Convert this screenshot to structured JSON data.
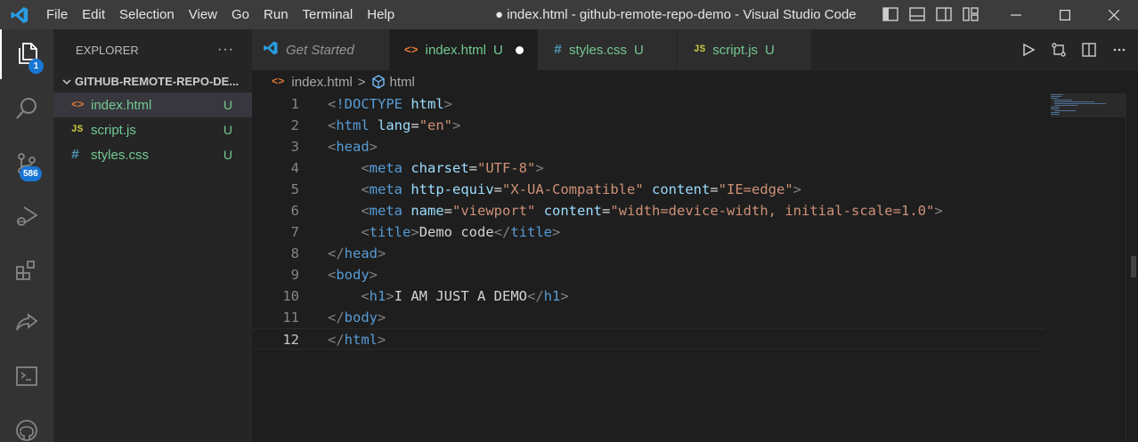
{
  "titlebar": {
    "menu": [
      "File",
      "Edit",
      "Selection",
      "View",
      "Go",
      "Run",
      "Terminal",
      "Help"
    ],
    "window_title": "● index.html - github-remote-repo-demo - Visual Studio Code"
  },
  "activity": {
    "explorer_badge": "1",
    "scm_badge": "586"
  },
  "sidebar": {
    "title": "EXPLORER",
    "more": "···",
    "folder": "GITHUB-REMOTE-REPO-DE...",
    "files": [
      {
        "icon": "<>",
        "name": "index.html",
        "status": "U"
      },
      {
        "icon": "JS",
        "name": "script.js",
        "status": "U"
      },
      {
        "icon": "#",
        "name": "styles.css",
        "status": "U"
      }
    ]
  },
  "tabs": [
    {
      "icon": "vscode-icon",
      "label": "Get Started",
      "status": ""
    },
    {
      "icon": "<>",
      "label": "index.html",
      "status": "U"
    },
    {
      "icon": "#",
      "label": "styles.css",
      "status": "U"
    },
    {
      "icon": "JS",
      "label": "script.js",
      "status": "U"
    }
  ],
  "breadcrumb": {
    "file": "index.html",
    "sep": ">",
    "symbol": "html"
  },
  "editor": {
    "current_line": 12,
    "lines": [
      {
        "n": "1",
        "tokens": [
          [
            "t-br",
            "<"
          ],
          [
            "t-doc",
            "!DOCTYPE"
          ],
          [
            "t-txt",
            " "
          ],
          [
            "t-attr",
            "html"
          ],
          [
            "t-br",
            ">"
          ]
        ]
      },
      {
        "n": "2",
        "tokens": [
          [
            "t-br",
            "<"
          ],
          [
            "t-tag",
            "html"
          ],
          [
            "t-txt",
            " "
          ],
          [
            "t-attr",
            "lang"
          ],
          [
            "t-txt",
            "="
          ],
          [
            "t-str",
            "\"en\""
          ],
          [
            "t-br",
            ">"
          ]
        ]
      },
      {
        "n": "3",
        "tokens": [
          [
            "t-br",
            "<"
          ],
          [
            "t-tag",
            "head"
          ],
          [
            "t-br",
            ">"
          ]
        ]
      },
      {
        "n": "4",
        "tokens": [
          [
            "t-txt",
            "    "
          ],
          [
            "t-br",
            "<"
          ],
          [
            "t-tag",
            "meta"
          ],
          [
            "t-txt",
            " "
          ],
          [
            "t-attr",
            "charset"
          ],
          [
            "t-txt",
            "="
          ],
          [
            "t-str",
            "\"UTF-8\""
          ],
          [
            "t-br",
            ">"
          ]
        ]
      },
      {
        "n": "5",
        "tokens": [
          [
            "t-txt",
            "    "
          ],
          [
            "t-br",
            "<"
          ],
          [
            "t-tag",
            "meta"
          ],
          [
            "t-txt",
            " "
          ],
          [
            "t-attr",
            "http-equiv"
          ],
          [
            "t-txt",
            "="
          ],
          [
            "t-str",
            "\"X-UA-Compatible\""
          ],
          [
            "t-txt",
            " "
          ],
          [
            "t-attr",
            "content"
          ],
          [
            "t-txt",
            "="
          ],
          [
            "t-str",
            "\"IE=edge\""
          ],
          [
            "t-br",
            ">"
          ]
        ]
      },
      {
        "n": "6",
        "tokens": [
          [
            "t-txt",
            "    "
          ],
          [
            "t-br",
            "<"
          ],
          [
            "t-tag",
            "meta"
          ],
          [
            "t-txt",
            " "
          ],
          [
            "t-attr",
            "name"
          ],
          [
            "t-txt",
            "="
          ],
          [
            "t-str",
            "\"viewport\""
          ],
          [
            "t-txt",
            " "
          ],
          [
            "t-attr",
            "content"
          ],
          [
            "t-txt",
            "="
          ],
          [
            "t-str",
            "\"width=device-width, initial-scale=1.0\""
          ],
          [
            "t-br",
            ">"
          ]
        ]
      },
      {
        "n": "7",
        "tokens": [
          [
            "t-txt",
            "    "
          ],
          [
            "t-br",
            "<"
          ],
          [
            "t-tag",
            "title"
          ],
          [
            "t-br",
            ">"
          ],
          [
            "t-txt",
            "Demo code"
          ],
          [
            "t-br",
            "</"
          ],
          [
            "t-tag",
            "title"
          ],
          [
            "t-br",
            ">"
          ]
        ]
      },
      {
        "n": "8",
        "tokens": [
          [
            "t-br",
            "</"
          ],
          [
            "t-tag",
            "head"
          ],
          [
            "t-br",
            ">"
          ]
        ]
      },
      {
        "n": "9",
        "tokens": [
          [
            "t-br",
            "<"
          ],
          [
            "t-tag",
            "body"
          ],
          [
            "t-br",
            ">"
          ]
        ]
      },
      {
        "n": "10",
        "tokens": [
          [
            "t-txt",
            "    "
          ],
          [
            "t-br",
            "<"
          ],
          [
            "t-tag",
            "h1"
          ],
          [
            "t-br",
            ">"
          ],
          [
            "t-txt",
            "I AM JUST A DEMO"
          ],
          [
            "t-br",
            "</"
          ],
          [
            "t-tag",
            "h1"
          ],
          [
            "t-br",
            ">"
          ]
        ]
      },
      {
        "n": "11",
        "tokens": [
          [
            "t-br",
            "</"
          ],
          [
            "t-tag",
            "body"
          ],
          [
            "t-br",
            ">"
          ]
        ]
      },
      {
        "n": "12",
        "tokens": [
          [
            "t-br",
            "</"
          ],
          [
            "t-tag",
            "html"
          ],
          [
            "t-br",
            ">"
          ]
        ]
      }
    ]
  },
  "colors": {
    "accent_blue": "#1877d4",
    "untracked_green": "#73c991",
    "editor_bg": "#1e1e1e"
  }
}
